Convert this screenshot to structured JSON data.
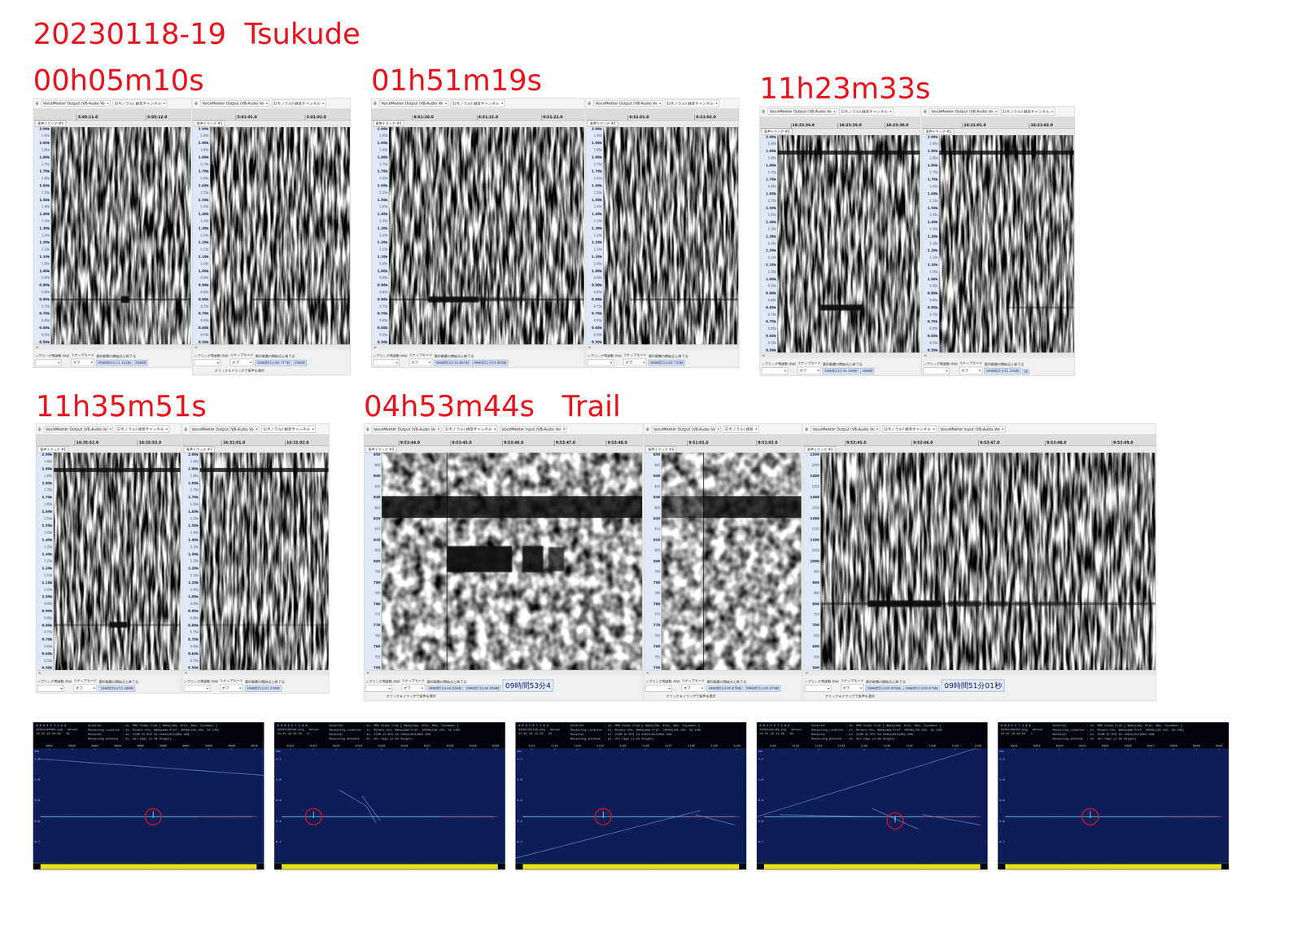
{
  "title": "20230118-19  Tsukude",
  "axes": {
    "wide": [
      "2.00k",
      "1.95k",
      "1.90k",
      "1.85k",
      "1.80k",
      "1.75k",
      "1.70k",
      "1.65k",
      "1.60k",
      "1.55k",
      "1.50k",
      "1.45k",
      "1.40k",
      "1.35k",
      "1.30k",
      "1.25k",
      "1.20k",
      "1.15k",
      "1.10k",
      "1.05k",
      "1.00k",
      "0.95k",
      "0.90k",
      "0.85k",
      "0.80k",
      "0.75k",
      "0.70k",
      "0.65k",
      "0.60k",
      "0.55k",
      "0.50k"
    ],
    "narrow": [
      "850",
      "845",
      "840",
      "835",
      "830",
      "825",
      "820",
      "815",
      "810",
      "805",
      "800",
      "795",
      "790",
      "785",
      "780",
      "775",
      "770",
      "765",
      "760",
      "755",
      "750"
    ],
    "mid": [
      "1500",
      "1450",
      "1400",
      "1350",
      "1300",
      "1250",
      "1200",
      "1150",
      "1100",
      "1050",
      "1000",
      "950",
      "900",
      "850",
      "800",
      "750",
      "700",
      "650",
      "600",
      "550",
      "500"
    ]
  },
  "ui": {
    "track": "音声トラック #1",
    "status_labels": [
      "ンプリング周波数 (Hz)",
      "スナップモード",
      "選択範囲の開始点と終了点"
    ],
    "snap": "オフ",
    "hint": "クリック＆ドラッグで音声を選択",
    "scroll_left": "<"
  },
  "events": [
    {
      "label": "00h05m10s",
      "shots": [
        {
          "devices": [
            "VoiceMeeter Output (VB-Audio Vo"
          ],
          "channel": "1(モノラル) 録音チャンネル",
          "ticks": [
            "5:05:11.0",
            "5:05:12.0"
          ],
          "axis": "wide",
          "times": [
            "05時間05分11.332秒",
            "05時間"
          ],
          "big": "",
          "hint": false,
          "cursor": null,
          "signals": [
            {
              "kind": "carrier",
              "freq": 810,
              "bw": 14,
              "start": 0,
              "end": 1,
              "strength": 0.5
            },
            {
              "kind": "echo",
              "freq": 810,
              "bw": 45,
              "start": 0.5,
              "end": 0.56,
              "strength": 1
            }
          ]
        },
        {
          "devices": [
            "VoiceMeeter Output (VB-Audio Vo"
          ],
          "channel": "1(モノラル) 録音チャンネル",
          "ticks": [
            "5:01:01.0",
            "5:01:02.0"
          ],
          "axis": "wide",
          "times": [
            "05時間51分00.777秒",
            "05時間"
          ],
          "big": "",
          "hint": true,
          "cursor": null,
          "signals": [
            {
              "kind": "carrier",
              "freq": 810,
              "bw": 14,
              "start": 0.3,
              "end": 1,
              "strength": 0.45
            }
          ]
        }
      ]
    },
    {
      "label": "01h51m19s",
      "shots": [
        {
          "devices": [
            "VoiceMeeter Output (VB-Audio Vo"
          ],
          "channel": "1(モノラル) 録音チャンネル",
          "ticks": [
            "6:51:20.0",
            "6:51:21.0",
            "6:51:22.0"
          ],
          "axis": "wide",
          "times": [
            "06時間51分19.805秒",
            "06時間51分19.805秒"
          ],
          "big": "",
          "hint": false,
          "cursor": null,
          "signals": [
            {
              "kind": "carrier",
              "freq": 810,
              "bw": 14,
              "start": 0,
              "end": 1,
              "strength": 0.5
            },
            {
              "kind": "echo",
              "freq": 810,
              "bw": 40,
              "start": 0.2,
              "end": 0.46,
              "strength": 0.95
            },
            {
              "kind": "echo",
              "freq": 812,
              "bw": 30,
              "start": 0.46,
              "end": 0.7,
              "strength": 0.5
            }
          ]
        },
        {
          "devices": [
            "VoiceMeeter Output (VB-Audio Vo"
          ],
          "channel": "1(モノラル) 録音チャンネル",
          "ticks": [
            "6:51:01.0",
            "6:51:02.0"
          ],
          "axis": "wide",
          "times": [
            "06時間51分00.735秒"
          ],
          "big": "",
          "hint": false,
          "cursor": null,
          "signals": [
            {
              "kind": "carrier",
              "freq": 810,
              "bw": 14,
              "start": 0.2,
              "end": 1,
              "strength": 0.45
            }
          ]
        }
      ]
    },
    {
      "label": "11h23m33s",
      "shots": [
        {
          "devices": [
            "VoiceMeeter Output (VB-Audio Vo"
          ],
          "channel": "1(モノラル) 録音チャンネル",
          "ticks": [
            "16:23:34.0",
            "16:23:35.0",
            "16:23:36.0"
          ],
          "axis": "wide",
          "times": [
            "16時間23分34.548秒",
            "16時間"
          ],
          "big": "",
          "hint": false,
          "cursor": null,
          "signals": [
            {
              "kind": "carrier",
              "freq": 1880,
              "bw": 28,
              "start": 0,
              "end": 1,
              "strength": 0.8
            },
            {
              "kind": "echo",
              "freq": 810,
              "bw": 40,
              "start": 0.3,
              "end": 0.6,
              "strength": 0.95
            }
          ]
        },
        {
          "devices": [
            "VoiceMeeter Output (VB-Audio Vo"
          ],
          "channel": "1(モノラル) 録音チャンネル",
          "ticks": [
            "16:21:01.0",
            "16:21:02.0"
          ],
          "axis": "wide",
          "times": [
            "16時間21分01.256秒",
            "16"
          ],
          "big": "",
          "hint": false,
          "cursor": null,
          "signals": [
            {
              "kind": "carrier",
              "freq": 1880,
              "bw": 28,
              "start": 0,
              "end": 1,
              "strength": 0.8
            },
            {
              "kind": "carrier",
              "freq": 810,
              "bw": 14,
              "start": 0.5,
              "end": 1,
              "strength": 0.3
            }
          ]
        }
      ]
    },
    {
      "label": "11h35m51s",
      "shots": [
        {
          "devices": [
            "VoiceMeeter Output (VB-Audio Vo"
          ],
          "channel": "1(モノラル) 録音チャンネル",
          "ticks": [
            "16:35:52.0",
            "16:35:53.0"
          ],
          "axis": "wide",
          "times": [
            "16時間35分52.088秒"
          ],
          "big": "",
          "hint": false,
          "cursor": 0.45,
          "signals": [
            {
              "kind": "carrier",
              "freq": 1880,
              "bw": 28,
              "start": 0,
              "end": 1,
              "strength": 0.8
            },
            {
              "kind": "carrier",
              "freq": 810,
              "bw": 14,
              "start": 0,
              "end": 1,
              "strength": 0.35
            },
            {
              "kind": "echo",
              "freq": 812,
              "bw": 40,
              "start": 0.44,
              "end": 0.58,
              "strength": 0.95
            }
          ]
        },
        {
          "devices": [
            "VoiceMeeter Output (VB-Audio Vo"
          ],
          "channel": "1(モノラル) 録音チャンネル",
          "ticks": [
            "16:31:01.0",
            "16:31:02.0"
          ],
          "axis": "wide",
          "times": [
            "16時間31分01.039秒"
          ],
          "big": "",
          "hint": false,
          "cursor": 0.4,
          "signals": [
            {
              "kind": "carrier",
              "freq": 1880,
              "bw": 28,
              "start": 0,
              "end": 1,
              "strength": 0.8
            },
            {
              "kind": "carrier",
              "freq": 810,
              "bw": 14,
              "start": 0,
              "end": 1,
              "strength": 0.2
            }
          ]
        }
      ]
    },
    {
      "label": "04h53m44s   Trail",
      "shots": [
        {
          "devices": [
            "VoiceMeeter Output (VB-Audio Vo",
            "VoiceMeeter Input (VB-Audio Voi"
          ],
          "channel": "1(モノラル) 録音チャンネル",
          "ticks": [
            "9:53:44.0",
            "9:53:45.0",
            "9:53:46.0",
            "9:53:47.0",
            "9:53:48.0"
          ],
          "axis": "narrow",
          "times": [
            "09時間53分44.856秒",
            "09時間53分44.856秒"
          ],
          "big": "09時間53分4",
          "hint": true,
          "cursor": 0.25,
          "signals": [
            {
              "kind": "carrier",
              "freq": 825,
              "bw": 10,
              "start": 0,
              "end": 1,
              "strength": 0.85
            },
            {
              "kind": "echo",
              "freq": 801,
              "bw": 12,
              "start": 0.25,
              "end": 0.5,
              "strength": 0.95
            },
            {
              "kind": "echo",
              "freq": 801,
              "bw": 12,
              "start": 0.54,
              "end": 0.62,
              "strength": 0.9
            },
            {
              "kind": "echo",
              "freq": 801,
              "bw": 11,
              "start": 0.64,
              "end": 0.7,
              "strength": 0.7
            }
          ]
        },
        {
          "devices": [
            "VoiceMeeter Output (VB-Audio Vo"
          ],
          "channel": "1(モノラル) 録音",
          "ticks": [
            "9:51:01.0",
            "9:51:02.0"
          ],
          "axis": "narrow",
          "times": [
            "09時間51分00.876秒",
            "09時間51分00.876秒"
          ],
          "big": "",
          "hint": true,
          "cursor": 0.3,
          "signals": [
            {
              "kind": "carrier",
              "freq": 825,
              "bw": 10,
              "start": 0,
              "end": 1,
              "strength": 0.6
            },
            {
              "kind": "carrier",
              "freq": 825,
              "bw": 10,
              "start": 0.3,
              "end": 1,
              "strength": 0.6
            }
          ]
        },
        {
          "devices": [
            "VoiceMeeter Output (VB-Audio Vo",
            "VoiceMeeter Input (VB-Audio Voi"
          ],
          "channel": "1(モノラル) 録音チャンネル",
          "ticks": [
            "9:53:45.0",
            "9:53:46.0",
            "9:53:47.0",
            "9:53:48.0",
            "9:53:49.0"
          ],
          "axis": "mid",
          "times": [
            "09時間51分00.876秒",
            "09時間51分00.876秒"
          ],
          "big": "09時間51分01秒",
          "hint": true,
          "cursor": null,
          "signals": [
            {
              "kind": "carrier",
              "freq": 805,
              "bw": 12,
              "start": 0,
              "end": 1,
              "strength": 0.45
            },
            {
              "kind": "echo",
              "freq": 805,
              "bw": 30,
              "start": 0.14,
              "end": 0.36,
              "strength": 0.95
            },
            {
              "kind": "echo",
              "freq": 805,
              "bw": 26,
              "start": 0.38,
              "end": 0.48,
              "strength": 0.7
            },
            {
              "kind": "echo",
              "freq": 805,
              "bw": 24,
              "start": 0.5,
              "end": 0.56,
              "strength": 0.6
            },
            {
              "kind": "echo",
              "freq": 805,
              "bw": 22,
              "start": 0.58,
              "end": 0.62,
              "strength": 0.5
            },
            {
              "kind": "echo",
              "freq": 805,
              "bw": 22,
              "start": 0.64,
              "end": 0.75,
              "strength": 0.4
            }
          ]
        }
      ]
    }
  ],
  "hrofft_header": {
    "brand": "H R O F F T 1 8 8",
    "unit": "kHz",
    "y_axis": [
      "1.1",
      "1.0",
      "0.9",
      "0.8",
      "0.7"
    ],
    "lines": [
      {
        "key": "Ovserver",
        "value": ": ex. RMG Video Club [ Nakajima, Arai, Abe, Toyomasu ]"
      },
      {
        "key": "Receiving Location",
        "value": ": ex. Minato-cho, Wakayama-Pref. JAPAN(135.41E, 34.14N)"
      },
      {
        "key": "Receiver",
        "value": ": ex. ICOM IC-R75 53.74922(RLO)MHz USB"
      },
      {
        "key": "Receiving antenna",
        "value": ": ex. 2el-Yagi (2.5m height)"
      }
    ]
  },
  "hrofft": [
    {
      "file": "H2301190000.png",
      "type": "meteor",
      "count": "30",
      "date": "23.01.19 00:00",
      "ticks": [
        "0001",
        "0002",
        "0003",
        "0004",
        "0005",
        "0006",
        "0007",
        "0008",
        "0009",
        "0010"
      ],
      "circle": {
        "x": 0.52,
        "f": 0.82
      },
      "traces": [
        [
          0.02,
          1.1,
          1.0,
          1.02
        ]
      ]
    },
    {
      "file": "H2301190150.png",
      "type": "meteor",
      "count": "8",
      "date": "23.01.19 01:50",
      "ticks": [
        "0151",
        "0152",
        "0153",
        "0154",
        "0155",
        "0156",
        "0157",
        "0158",
        "0159",
        "0200"
      ],
      "circle": {
        "x": 0.17,
        "f": 0.82
      },
      "traces": [
        [
          0.28,
          0.95,
          0.4,
          0.87
        ],
        [
          0.4,
          0.87,
          0.44,
          0.79
        ],
        [
          0.38,
          0.92,
          0.46,
          0.8
        ]
      ]
    },
    {
      "file": "H2301191120.png",
      "type": "meteor",
      "count": "32",
      "date": "23.01.19 11:20",
      "ticks": [
        "1121",
        "1122",
        "1123",
        "1124",
        "1125",
        "1126",
        "1127",
        "1128",
        "1129",
        "1130"
      ],
      "circle": {
        "x": 0.38,
        "f": 0.82
      },
      "traces": [
        [
          0.0,
          0.62,
          0.8,
          0.85
        ],
        [
          0.78,
          0.83,
          0.95,
          0.78
        ]
      ]
    },
    {
      "file": "H2301191130.png",
      "type": "meteor",
      "count": "29",
      "date": "23.01.19 11:30",
      "ticks": [
        "1131",
        "1132",
        "1133",
        "1134",
        "1135",
        "1136",
        "1137",
        "1138",
        "1139",
        "1140"
      ],
      "circle": {
        "x": 0.6,
        "f": 0.8
      },
      "traces": [
        [
          0.0,
          0.82,
          0.95,
          1.15
        ],
        [
          0.1,
          0.83,
          0.5,
          0.82
        ],
        [
          0.5,
          0.86,
          0.7,
          0.76
        ],
        [
          0.72,
          0.83,
          0.97,
          0.78
        ]
      ]
    },
    {
      "file": "H2301190450.png",
      "type": "meteor",
      "count": "1",
      "date": "23.01.19 04:50",
      "ticks": [
        "0451",
        "0452",
        "0453",
        "0454",
        "0455",
        "0456",
        "0457",
        "0458",
        "0459",
        "0500"
      ],
      "circle": {
        "x": 0.4,
        "f": 0.82
      },
      "traces": []
    }
  ]
}
